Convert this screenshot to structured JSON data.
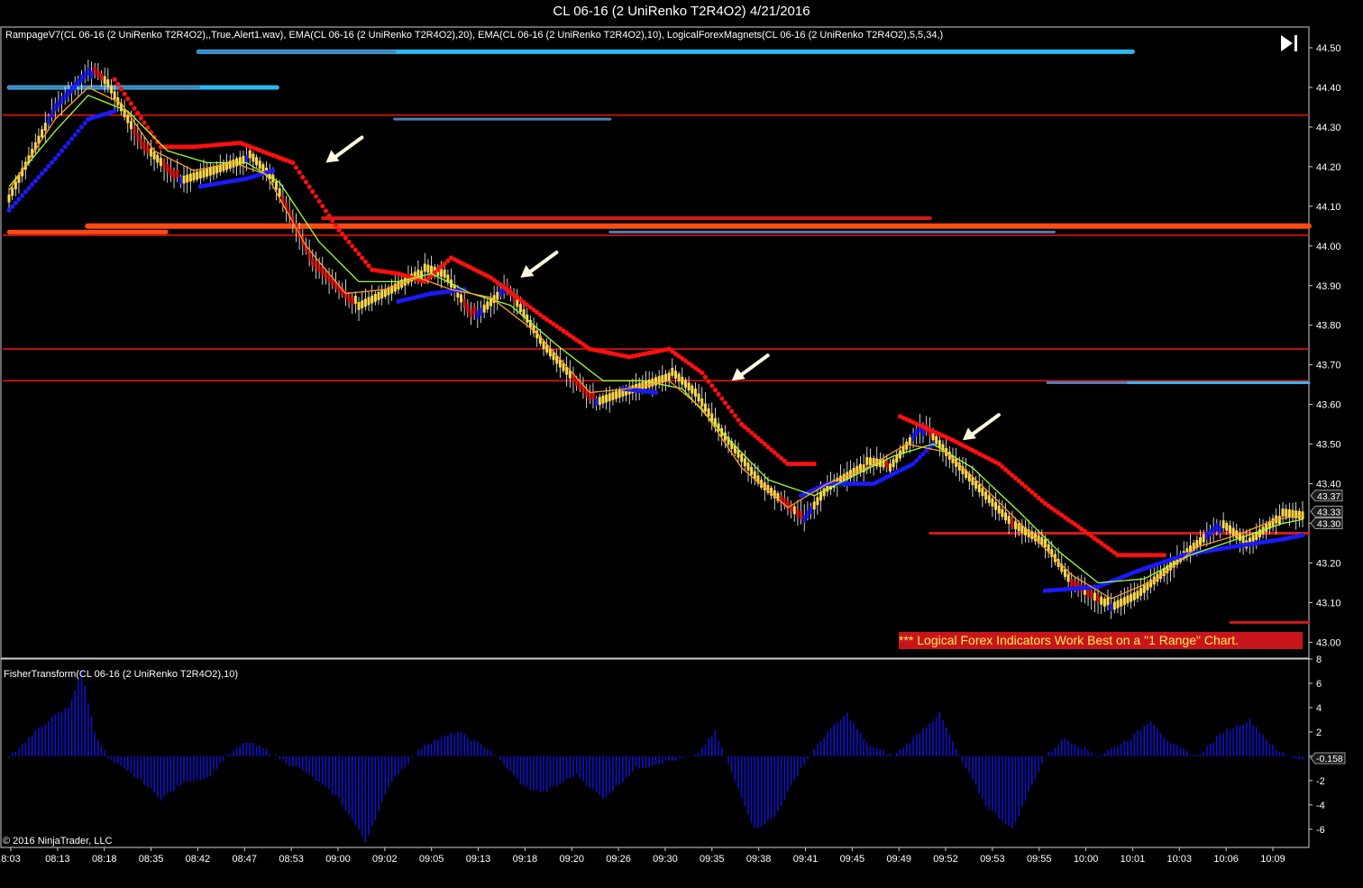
{
  "window": {
    "title": "CL 06-16 (2 UniRenko T2R4O2)  4/21/2016"
  },
  "indicators": {
    "main_label": "RampageV7(CL 06-16 (2 UniRenko T2R4O2),,True,Alert1.wav), EMA(CL 06-16 (2 UniRenko T2R4O2),20), EMA(CL 06-16 (2 UniRenko T2R4O2),10), LogicalForexMagnets(CL 06-16 (2 UniRenko T2R4O2),5,5,34,)",
    "sub_label": "FisherTransform(CL 06-16 (2 UniRenko T2R4O2),10)"
  },
  "note": {
    "stars": "***",
    "text": " Logical Forex Indicators Work Best on a \"1 Range\" Chart."
  },
  "copyright": "© 2016 NinjaTrader, LLC",
  "colors": {
    "background": "#000000",
    "bull_bar": "#1a1aff",
    "bear_bar": "#dd1111",
    "neutral_bar": "#ffd84a",
    "ema10": "#ff9c2a",
    "ema20": "#9cff3a",
    "trail_red": "#ff1010",
    "trail_blue": "#1a1aff",
    "magnet_red": "#d11a1a",
    "magnet_orange": "#ff4a12",
    "magnet_blue": "#2ab8f0",
    "magnet_steel": "#4a7fb8",
    "fisher": "#1010cc",
    "note_bg": "#c8151b",
    "note_text": "#ffee55"
  },
  "icons": {
    "scroll_end": "skip-to-end-icon"
  },
  "chart_data": [
    {
      "type": "candlestick",
      "name": "price",
      "ylim": [
        42.96,
        44.55
      ],
      "yticks": [
        "44.50",
        "44.40",
        "44.30",
        "44.20",
        "44.10",
        "44.00",
        "43.90",
        "43.80",
        "43.70",
        "43.60",
        "43.50",
        "43.40",
        "43.30",
        "43.20",
        "43.10",
        "43.00"
      ],
      "ytick_values": [
        44.5,
        44.4,
        44.3,
        44.2,
        44.1,
        44.0,
        43.9,
        43.8,
        43.7,
        43.6,
        43.5,
        43.4,
        43.3,
        43.2,
        43.1,
        43.0
      ],
      "price_markers": [
        {
          "label": "43.37",
          "value": 43.37
        },
        {
          "label": "43.33",
          "value": 43.33
        },
        {
          "label": "43.30",
          "value": 43.3
        }
      ],
      "xlabels": [
        "8:03",
        "08:13",
        "08:18",
        "08:35",
        "08:42",
        "08:47",
        "08:53",
        "09:00",
        "09:02",
        "09:05",
        "09:13",
        "09:18",
        "09:20",
        "09:26",
        "09:30",
        "09:35",
        "09:38",
        "09:41",
        "09:45",
        "09:49",
        "09:52",
        "09:53",
        "09:55",
        "10:00",
        "10:01",
        "10:03",
        "10:06",
        "10:09"
      ],
      "close_path": [
        [
          0,
          44.13
        ],
        [
          14,
          44.36
        ],
        [
          24,
          44.45
        ],
        [
          30,
          44.4
        ],
        [
          40,
          44.25
        ],
        [
          50,
          44.17
        ],
        [
          62,
          44.2
        ],
        [
          72,
          44.23
        ],
        [
          80,
          44.16
        ],
        [
          92,
          43.95
        ],
        [
          104,
          43.85
        ],
        [
          116,
          43.9
        ],
        [
          124,
          43.94
        ],
        [
          132,
          43.92
        ],
        [
          140,
          43.82
        ],
        [
          150,
          43.9
        ],
        [
          162,
          43.74
        ],
        [
          176,
          43.61
        ],
        [
          186,
          43.64
        ],
        [
          200,
          43.68
        ],
        [
          208,
          43.62
        ],
        [
          216,
          43.52
        ],
        [
          228,
          43.39
        ],
        [
          240,
          43.31
        ],
        [
          248,
          43.4
        ],
        [
          258,
          43.45
        ],
        [
          266,
          43.44
        ],
        [
          276,
          43.55
        ],
        [
          284,
          43.47
        ],
        [
          296,
          43.36
        ],
        [
          304,
          43.29
        ],
        [
          314,
          43.24
        ],
        [
          322,
          43.14
        ],
        [
          332,
          43.09
        ],
        [
          342,
          43.13
        ],
        [
          356,
          43.23
        ],
        [
          366,
          43.3
        ],
        [
          374,
          43.25
        ],
        [
          384,
          43.32
        ],
        [
          392,
          43.31
        ]
      ],
      "ema10_path": [
        [
          0,
          44.14
        ],
        [
          14,
          44.32
        ],
        [
          24,
          44.4
        ],
        [
          34,
          44.36
        ],
        [
          44,
          44.24
        ],
        [
          56,
          44.19
        ],
        [
          68,
          44.21
        ],
        [
          78,
          44.18
        ],
        [
          90,
          44.0
        ],
        [
          102,
          43.88
        ],
        [
          114,
          43.89
        ],
        [
          124,
          43.92
        ],
        [
          134,
          43.89
        ],
        [
          146,
          43.87
        ],
        [
          160,
          43.78
        ],
        [
          176,
          43.63
        ],
        [
          188,
          43.64
        ],
        [
          200,
          43.66
        ],
        [
          210,
          43.59
        ],
        [
          222,
          43.44
        ],
        [
          236,
          43.34
        ],
        [
          248,
          43.4
        ],
        [
          260,
          43.44
        ],
        [
          272,
          43.5
        ],
        [
          284,
          43.48
        ],
        [
          298,
          43.37
        ],
        [
          310,
          43.27
        ],
        [
          322,
          43.17
        ],
        [
          334,
          43.11
        ],
        [
          348,
          43.16
        ],
        [
          360,
          43.24
        ],
        [
          372,
          43.27
        ],
        [
          384,
          43.31
        ],
        [
          392,
          43.32
        ]
      ],
      "ema20_path": [
        [
          0,
          44.15
        ],
        [
          14,
          44.29
        ],
        [
          24,
          44.38
        ],
        [
          36,
          44.34
        ],
        [
          48,
          44.24
        ],
        [
          60,
          44.21
        ],
        [
          72,
          44.21
        ],
        [
          82,
          44.16
        ],
        [
          94,
          44.01
        ],
        [
          106,
          43.91
        ],
        [
          118,
          43.91
        ],
        [
          128,
          43.93
        ],
        [
          140,
          43.88
        ],
        [
          152,
          43.85
        ],
        [
          166,
          43.75
        ],
        [
          180,
          43.66
        ],
        [
          192,
          43.66
        ],
        [
          204,
          43.64
        ],
        [
          216,
          43.53
        ],
        [
          230,
          43.41
        ],
        [
          244,
          43.37
        ],
        [
          256,
          43.42
        ],
        [
          268,
          43.47
        ],
        [
          280,
          43.5
        ],
        [
          292,
          43.44
        ],
        [
          306,
          43.33
        ],
        [
          318,
          43.23
        ],
        [
          330,
          43.15
        ],
        [
          344,
          43.16
        ],
        [
          358,
          43.22
        ],
        [
          372,
          43.26
        ],
        [
          386,
          43.3
        ],
        [
          392,
          43.31
        ]
      ],
      "trail_red_path": [
        [
          32,
          44.42
        ],
        [
          46,
          44.25
        ],
        [
          56,
          44.25
        ],
        [
          70,
          44.26
        ],
        [
          86,
          44.21
        ],
        [
          100,
          44.04
        ],
        [
          110,
          43.94
        ],
        [
          118,
          43.93
        ],
        [
          126,
          43.91
        ],
        [
          134,
          43.97
        ],
        [
          146,
          43.92
        ],
        [
          162,
          43.82
        ],
        [
          176,
          43.74
        ],
        [
          188,
          43.72
        ],
        [
          200,
          43.74
        ],
        [
          210,
          43.68
        ],
        [
          222,
          43.55
        ],
        [
          236,
          43.45
        ],
        [
          244,
          43.45
        ],
        [
          270,
          43.57
        ],
        [
          286,
          43.51
        ],
        [
          300,
          43.45
        ],
        [
          314,
          43.35
        ],
        [
          326,
          43.28
        ],
        [
          336,
          43.22
        ],
        [
          350,
          43.22
        ]
      ],
      "trail_blue_path": [
        [
          0,
          44.09
        ],
        [
          14,
          44.22
        ],
        [
          24,
          44.32
        ],
        [
          32,
          44.34
        ],
        [
          58,
          44.15
        ],
        [
          72,
          44.17
        ],
        [
          80,
          44.19
        ],
        [
          118,
          43.86
        ],
        [
          128,
          43.88
        ],
        [
          138,
          43.89
        ],
        [
          186,
          43.64
        ],
        [
          196,
          43.63
        ],
        [
          240,
          43.37
        ],
        [
          248,
          43.4
        ],
        [
          262,
          43.4
        ],
        [
          274,
          43.45
        ],
        [
          280,
          43.5
        ],
        [
          314,
          43.13
        ],
        [
          330,
          43.14
        ],
        [
          342,
          43.18
        ],
        [
          356,
          43.22
        ],
        [
          370,
          43.24
        ],
        [
          386,
          43.26
        ],
        [
          392,
          43.27
        ]
      ],
      "x_count": 393,
      "horizontal_levels": [
        {
          "value": 44.33,
          "color": "red",
          "from": 0,
          "to": 1.0
        },
        {
          "value": 43.74,
          "color": "red",
          "from": 0,
          "to": 1.0
        },
        {
          "value": 43.66,
          "color": "red",
          "from": 0,
          "to": 1.0
        },
        {
          "value": 44.027,
          "color": "red",
          "from": 0,
          "to": 1.0
        }
      ],
      "magnet_zones": [
        {
          "value": 44.49,
          "color": "blue",
          "from": 0.15,
          "to": 0.865,
          "weight": 5
        },
        {
          "value": 44.49,
          "color": "steel",
          "from": 0.15,
          "to": 0.3,
          "weight": 3
        },
        {
          "value": 44.4,
          "color": "blue",
          "from": 0.005,
          "to": 0.21,
          "weight": 5
        },
        {
          "value": 44.4,
          "color": "steel",
          "from": 0.005,
          "to": 0.15,
          "weight": 3
        },
        {
          "value": 44.32,
          "color": "steel",
          "from": 0.3,
          "to": 0.465,
          "weight": 3
        },
        {
          "value": 44.07,
          "color": "darkred",
          "from": 0.245,
          "to": 0.71,
          "weight": 4
        },
        {
          "value": 44.05,
          "color": "orange",
          "from": 0.065,
          "to": 1.0,
          "weight": 6
        },
        {
          "value": 44.035,
          "color": "steel",
          "from": 0.465,
          "to": 0.805,
          "weight": 3
        },
        {
          "value": 44.035,
          "color": "orange",
          "from": 0.005,
          "to": 0.125,
          "weight": 5
        },
        {
          "value": 43.655,
          "color": "blue",
          "from": 0.8,
          "to": 1.0,
          "weight": 3
        },
        {
          "value": 43.655,
          "color": "steel",
          "from": 0.8,
          "to": 0.86,
          "weight": 3
        },
        {
          "value": 43.275,
          "color": "darkred",
          "from": 0.71,
          "to": 1.0,
          "weight": 3
        },
        {
          "value": 43.05,
          "color": "darkred",
          "from": 0.94,
          "to": 1.0,
          "weight": 3
        }
      ],
      "arrows": [
        {
          "x": 96,
          "y": 44.21
        },
        {
          "x": 155,
          "y": 43.92
        },
        {
          "x": 219,
          "y": 43.66
        },
        {
          "x": 289,
          "y": 43.51
        }
      ]
    },
    {
      "type": "bar",
      "name": "fisher-transform",
      "ylim": [
        -7.5,
        8
      ],
      "yticks": [
        "8",
        "6",
        "4",
        "2",
        "",
        "-2",
        "-4",
        "-6"
      ],
      "ytick_values": [
        8,
        6,
        4,
        2,
        0,
        -2,
        -4,
        -6
      ],
      "price_marker": {
        "label": "-0.158",
        "value": -0.158
      },
      "wave_path": [
        [
          0,
          0
        ],
        [
          6,
          1.5
        ],
        [
          12,
          3
        ],
        [
          18,
          4
        ],
        [
          22,
          7
        ],
        [
          26,
          2
        ],
        [
          30,
          -0.2
        ],
        [
          40,
          -2
        ],
        [
          46,
          -3.5
        ],
        [
          54,
          -2
        ],
        [
          60,
          -1.8
        ],
        [
          66,
          0
        ],
        [
          72,
          1.2
        ],
        [
          78,
          0.5
        ],
        [
          84,
          -0.5
        ],
        [
          90,
          -1.3
        ],
        [
          100,
          -3.5
        ],
        [
          108,
          -7
        ],
        [
          116,
          -2
        ],
        [
          126,
          1
        ],
        [
          136,
          2
        ],
        [
          146,
          0.5
        ],
        [
          156,
          -2.5
        ],
        [
          162,
          -3
        ],
        [
          172,
          -1.5
        ],
        [
          180,
          -3.5
        ],
        [
          190,
          -1
        ],
        [
          198,
          -0.5
        ],
        [
          208,
          0
        ],
        [
          214,
          2
        ],
        [
          220,
          -2
        ],
        [
          226,
          -6
        ],
        [
          232,
          -5
        ],
        [
          240,
          -1
        ],
        [
          248,
          2
        ],
        [
          254,
          3.5
        ],
        [
          260,
          1
        ],
        [
          268,
          0
        ],
        [
          276,
          2
        ],
        [
          282,
          3.5
        ],
        [
          288,
          0
        ],
        [
          296,
          -4
        ],
        [
          304,
          -6
        ],
        [
          314,
          0
        ],
        [
          320,
          1.5
        ],
        [
          330,
          0
        ],
        [
          340,
          1.5
        ],
        [
          346,
          3
        ],
        [
          352,
          1
        ],
        [
          360,
          0
        ],
        [
          368,
          2
        ],
        [
          376,
          3
        ],
        [
          384,
          0.5
        ],
        [
          390,
          -0.2
        ],
        [
          392,
          -0.16
        ]
      ]
    }
  ]
}
